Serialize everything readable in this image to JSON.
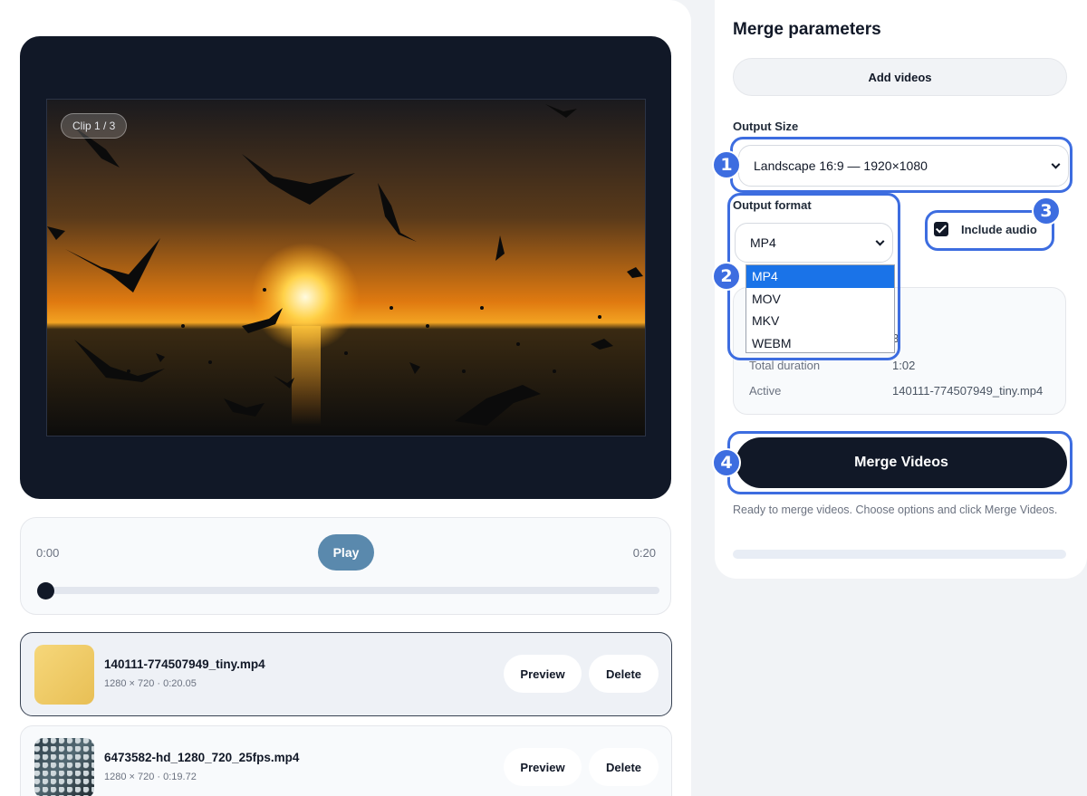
{
  "player": {
    "clip_badge": "Clip 1 / 3",
    "time_start": "0:00",
    "time_end": "0:20",
    "play_label": "Play",
    "seek_progress": 0.0
  },
  "clips": [
    {
      "name": "140111-774507949_tiny.mp4",
      "meta": "1280 × 720 · 0:20.05",
      "preview_label": "Preview",
      "delete_label": "Delete"
    },
    {
      "name": "6473582-hd_1280_720_25fps.mp4",
      "meta": "1280 × 720 · 0:19.72",
      "preview_label": "Preview",
      "delete_label": "Delete"
    }
  ],
  "merge_panel": {
    "title": "Merge parameters",
    "add_videos_label": "Add videos",
    "output_size_label": "Output Size",
    "output_size_value": "Landscape 16:9 — 1920×1080",
    "output_format_label": "Output format",
    "output_format_value": "MP4",
    "format_options": [
      "MP4",
      "MOV",
      "MKV",
      "WEBM"
    ],
    "include_audio_label": "Include audio",
    "include_audio_checked": true,
    "stats": {
      "partial_value": "3",
      "total_duration_label": "Total duration",
      "total_duration_value": "1:02",
      "active_label": "Active",
      "active_value": "140111-774507949_tiny.mp4"
    },
    "merge_label": "Merge Videos",
    "status_text": "Ready to merge videos. Choose options and click Merge Videos.",
    "progress": 0.0
  },
  "annotations": [
    "1",
    "2",
    "3",
    "4"
  ],
  "colors": {
    "accent": "#3d6de0",
    "dark": "#111827",
    "play_button": "#5a89ad",
    "dropdown_selected": "#1a73e8"
  }
}
